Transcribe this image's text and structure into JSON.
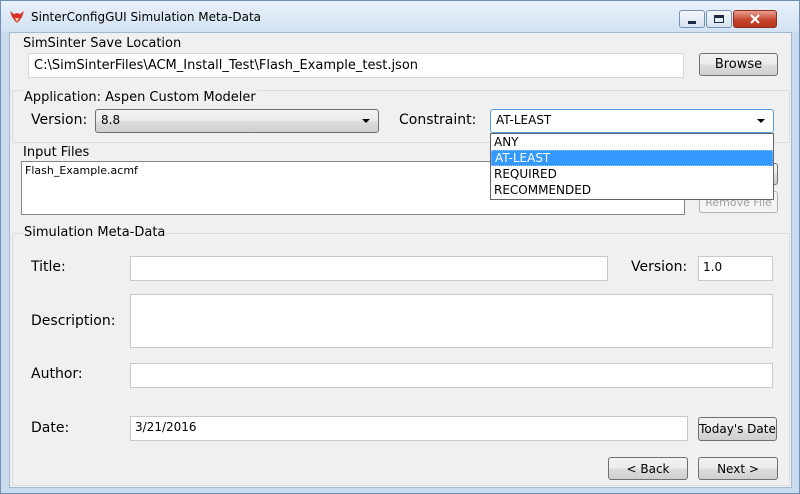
{
  "window": {
    "title": "SinterConfigGUI Simulation Meta-Data",
    "icon": "fox-app-icon",
    "controls": [
      "minimize-icon",
      "maximize-icon",
      "close-icon"
    ]
  },
  "save_location": {
    "section_label": "SimSinter Save Location",
    "path": "C:\\SimSinterFiles\\ACM_Install_Test\\Flash_Example_test.json",
    "browse_label": "Browse"
  },
  "application": {
    "section_label": "Application: Aspen Custom Modeler",
    "version_label": "Version:",
    "version_value": "8.8",
    "constraint_label": "Constraint:",
    "constraint_value": "AT-LEAST",
    "constraint_options": [
      "ANY",
      "AT-LEAST",
      "REQUIRED",
      "RECOMMENDED"
    ],
    "constraint_selected_index": 1
  },
  "input_files": {
    "section_label": "Input Files",
    "files": [
      "Flash_Example.acmf"
    ],
    "remove_label": "Remove File"
  },
  "meta": {
    "section_label": "Simulation Meta-Data",
    "title_label": "Title:",
    "title_value": "",
    "version_label": "Version:",
    "version_value": "1.0",
    "description_label": "Description:",
    "description_value": "",
    "author_label": "Author:",
    "author_value": "",
    "date_label": "Date:",
    "date_value": "3/21/2016",
    "today_label": "Today's Date"
  },
  "nav": {
    "back_label": "< Back",
    "next_label": "Next >"
  }
}
